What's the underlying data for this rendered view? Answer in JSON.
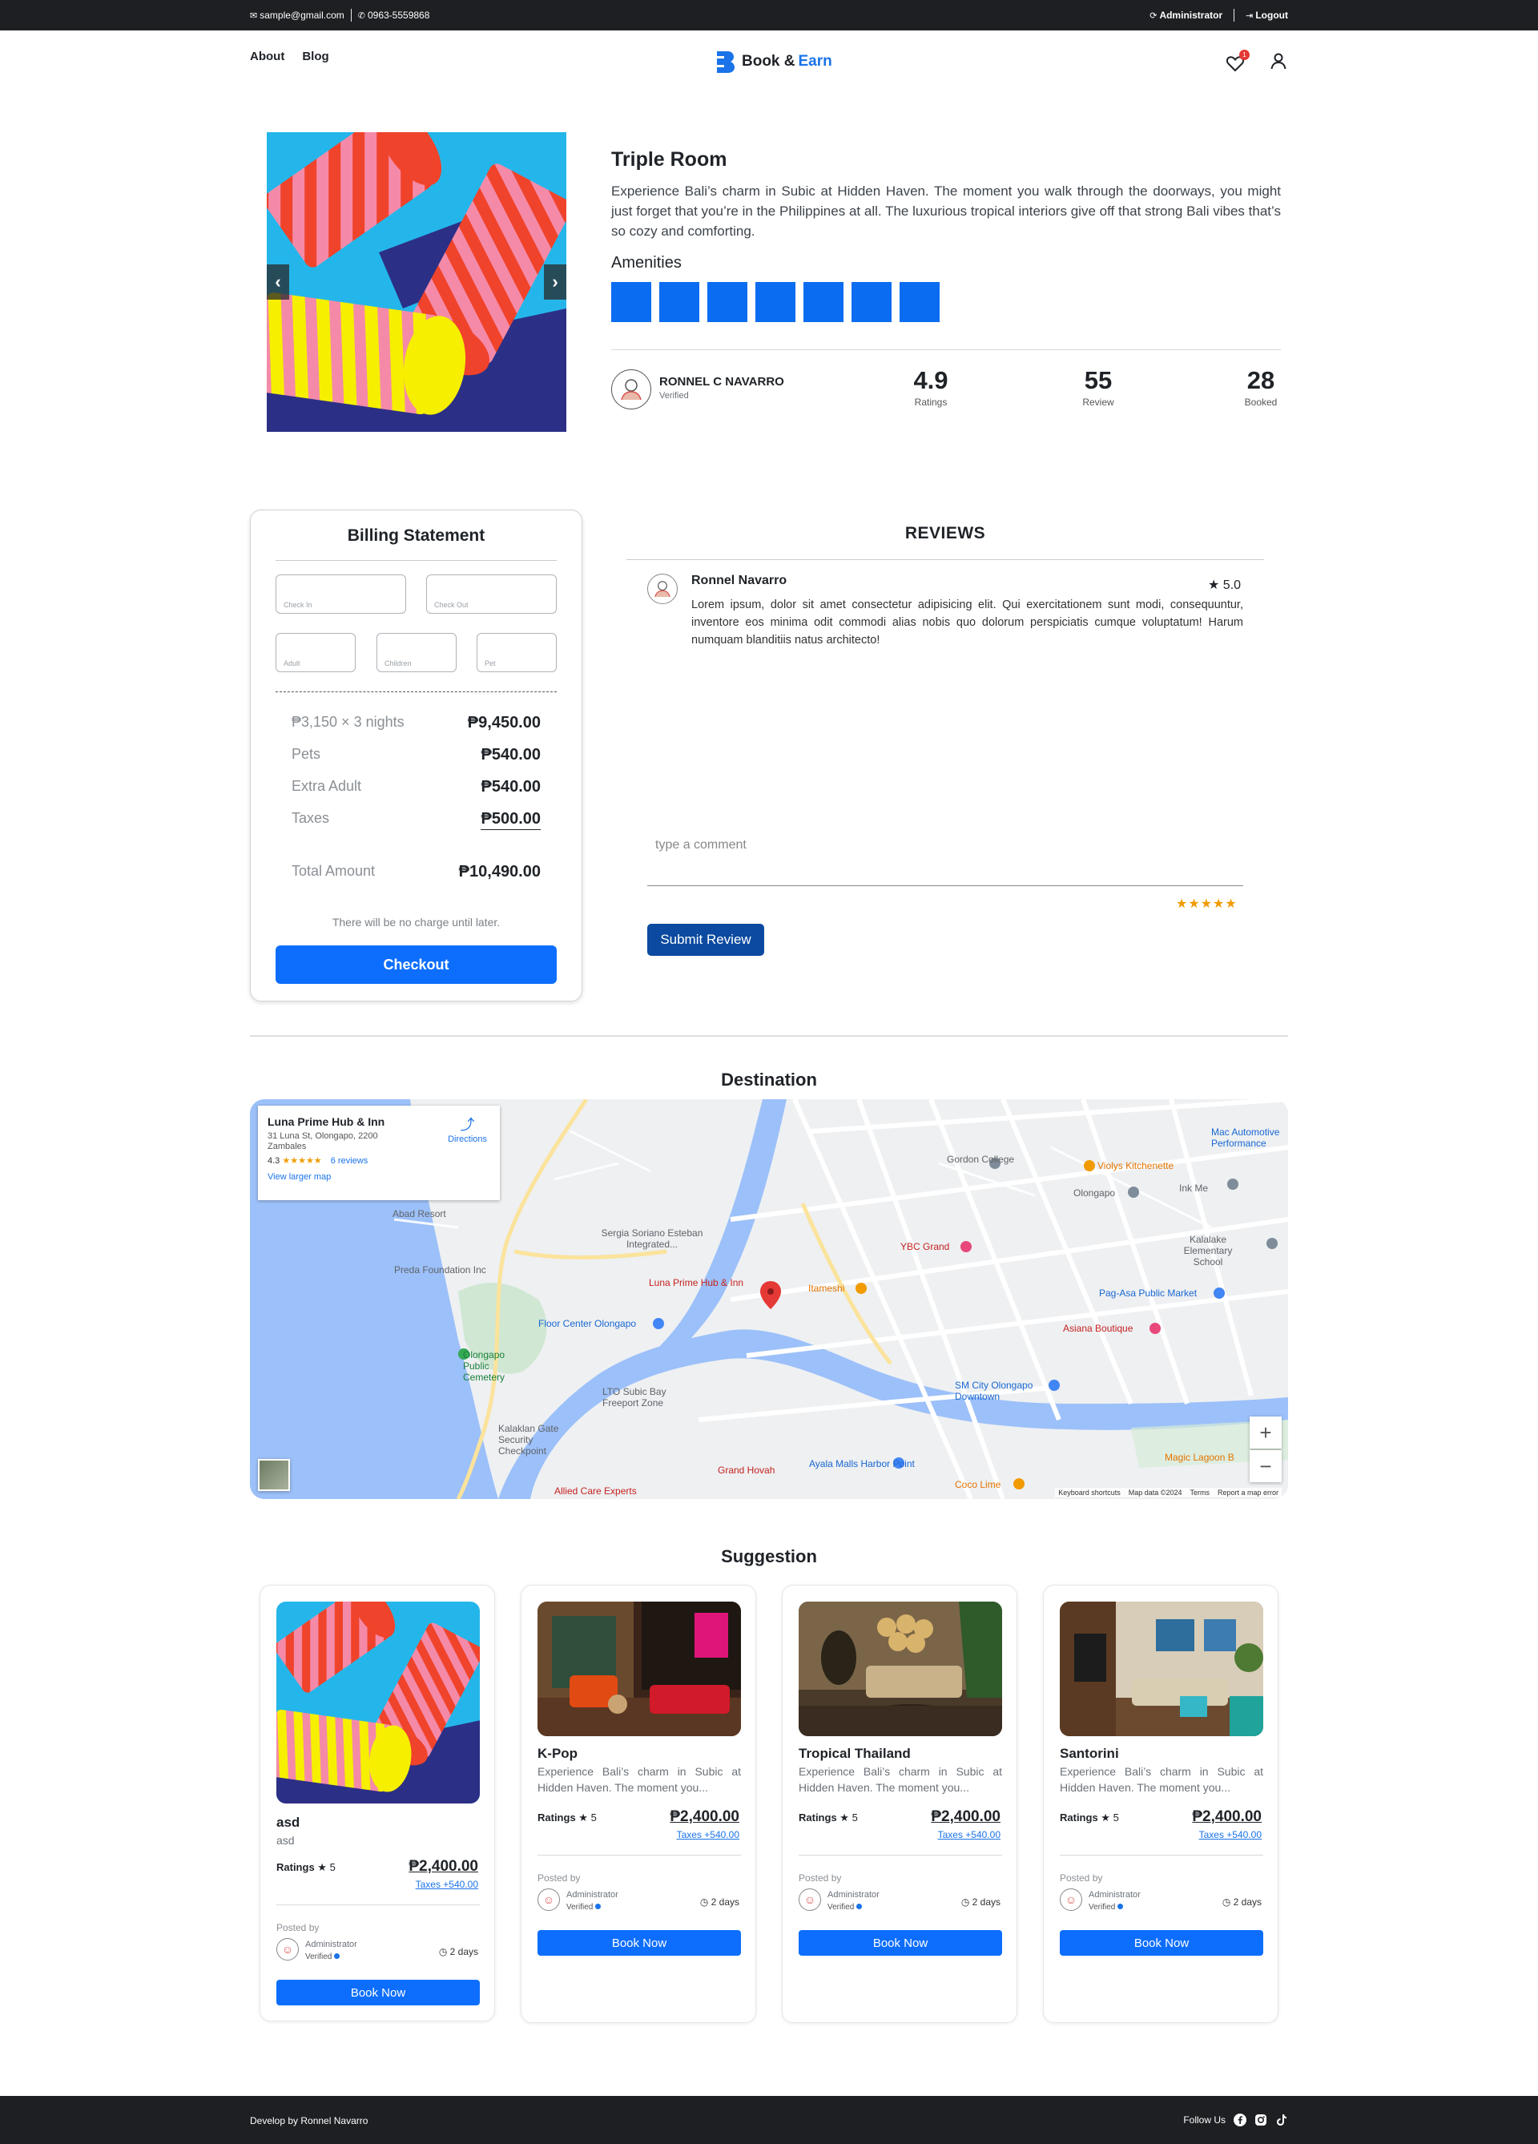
{
  "topbar": {
    "email": "sample@gmail.com",
    "phone": "0963-5559868",
    "role": "Administrator",
    "logout": "Logout"
  },
  "nav": {
    "links": [
      "About",
      "Blog"
    ],
    "brand_part1": "Book & ",
    "brand_part2": "Earn",
    "wishlist_count": "1"
  },
  "room": {
    "title": "Triple Room",
    "description": "Experience Bali’s charm in Subic at Hidden Haven. The moment you walk through the doorways, you might just forget that you’re in the Philippines at all. The luxurious tropical interiors give off that strong Bali vibes that’s so cozy and comforting.",
    "amenities_title": "Amenities",
    "amenity_count": 7,
    "host": {
      "name": "RONNEL C NAVARRO",
      "status": "Verified"
    },
    "stats": [
      {
        "value": "4.9",
        "label": "Ratings"
      },
      {
        "value": "55",
        "label": "Review"
      },
      {
        "value": "28",
        "label": "Booked"
      }
    ]
  },
  "billing": {
    "title": "Billing Statement",
    "fields": {
      "check_in": "Check In",
      "check_out": "Check Out",
      "adult": "Adult",
      "children": "Children",
      "pet": "Pet"
    },
    "lines": [
      {
        "label": "₱3,150 × 3 nights",
        "value": "₱9,450.00"
      },
      {
        "label": "Pets",
        "value": "₱540.00"
      },
      {
        "label": "Extra Adult",
        "value": "₱540.00"
      },
      {
        "label": "Taxes",
        "value": "₱500.00"
      }
    ],
    "total_label": "Total Amount",
    "total_value": "₱10,490.00",
    "note": "There will be no charge until later.",
    "checkout": "Checkout"
  },
  "reviews": {
    "title": "REVIEWS",
    "items": [
      {
        "name": "Ronnel Navarro",
        "score": "5.0",
        "text": "Lorem ipsum, dolor sit amet consectetur adipisicing elit. Qui exercitationem sunt modi, consequuntur, inventore eos minima odit commodi alias nobis quo dolorum perspiciatis cumque voluptatum! Harum numquam blanditiis natus architecto!"
      }
    ],
    "comment_placeholder": "type a comment",
    "rating_stars": 5,
    "submit": "Submit Review"
  },
  "destination": {
    "title": "Destination",
    "card": {
      "name": "Luna Prime Hub & Inn",
      "address": "31 Luna St, Olongapo, 2200 Zambales",
      "rating": "4.3",
      "reviews": "6 reviews",
      "larger_map": "View larger map",
      "directions": "Directions"
    },
    "labels": {
      "pin": "Luna Prime Hub & Inn",
      "l1": "Gordon College",
      "l2": "Violys Kitchenette",
      "l3": "YBC Grand",
      "l4": "Itameshi",
      "l5": "Pag-Asa Public Market",
      "l6": "Asiana Boutique",
      "l7": "SM City Olongapo Downtown",
      "l8": "Floor Center Olongapo",
      "l9": "Olongapo Public Cemetery",
      "l10": "Abad Resort",
      "l11": "Preda Foundation Inc",
      "l12": "Sergia Soriano Esteban Integrated...",
      "l13": "LTO Subic Bay Freeport Zone",
      "l14": "Kalaklan Gate Security Checkpoint",
      "l15": "Ayala Malls Harbor Point",
      "l16": "Coco Lime",
      "l17": "Grand Hovah",
      "l18": "Allied Care Experts",
      "l19": "Olongapo",
      "l20": "Kalalake Elementary School",
      "l21": "Magic Lagoon B",
      "l22": "Mac Automotive Performance",
      "l23": "Ink Me"
    },
    "footer": [
      "Keyboard shortcuts",
      "Map data ©2024",
      "Terms",
      "Report a map error"
    ]
  },
  "suggestions": {
    "title": "Suggestion",
    "posted_by": "Posted by",
    "admin": "Administrator",
    "verified": "Verified",
    "ratings_label": "Ratings",
    "book": "Book Now",
    "items": [
      {
        "title": "asd",
        "desc": "asd",
        "rating": "5",
        "price": "₱2,400.00",
        "taxes": "Taxes +540.00",
        "days": "2 days"
      },
      {
        "title": "K-Pop",
        "desc": "Experience Bali’s charm in Subic at Hidden Haven. The moment you...",
        "rating": "5",
        "price": "₱2,400.00",
        "taxes": "Taxes +540.00",
        "days": "2 days"
      },
      {
        "title": "Tropical Thailand",
        "desc": "Experience Bali’s charm in Subic at Hidden Haven. The moment you...",
        "rating": "5",
        "price": "₱2,400.00",
        "taxes": "Taxes +540.00",
        "days": "2 days"
      },
      {
        "title": "Santorini",
        "desc": "Experience Bali’s charm in Subic at Hidden Haven. The moment you...",
        "rating": "5",
        "price": "₱2,400.00",
        "taxes": "Taxes +540.00",
        "days": "2 days"
      }
    ]
  },
  "footer": {
    "credit": "Develop by Ronnel Navarro",
    "follow": "Follow Us"
  }
}
